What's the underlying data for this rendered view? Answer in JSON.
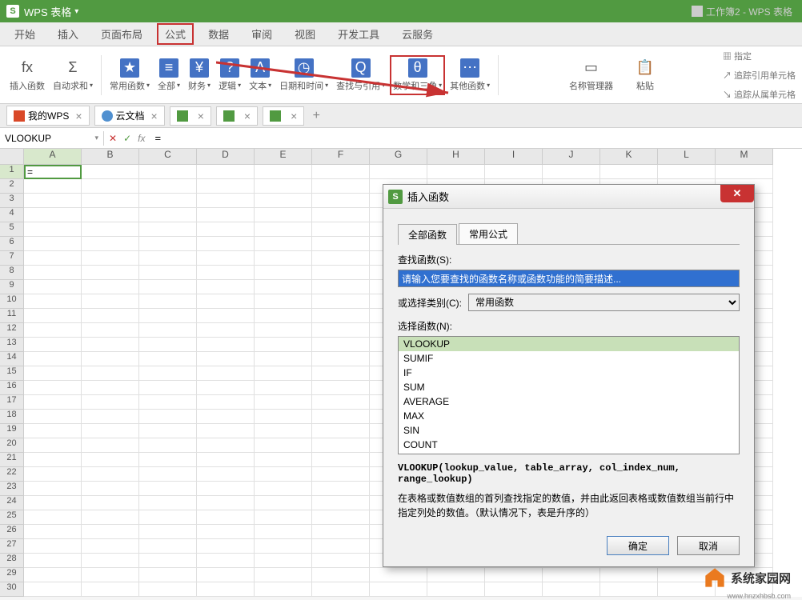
{
  "title_bar": {
    "app": "WPS 表格",
    "doc": "工作簿2 - WPS 表格"
  },
  "menu": {
    "items": [
      "开始",
      "插入",
      "页面布局",
      "公式",
      "数据",
      "审阅",
      "视图",
      "开发工具",
      "云服务"
    ],
    "active": "公式"
  },
  "ribbon": {
    "groups": [
      {
        "id": "insert-func",
        "icon": "fx",
        "label": "插入函数",
        "color": "plain"
      },
      {
        "id": "autosum",
        "icon": "Σ",
        "label": "自动求和",
        "color": "plain",
        "arrow": true
      },
      {
        "id": "common",
        "icon": "★",
        "label": "常用函数",
        "color": "blue",
        "arrow": true
      },
      {
        "id": "all",
        "icon": "≡",
        "label": "全部",
        "color": "blue",
        "arrow": true
      },
      {
        "id": "finance",
        "icon": "¥",
        "label": "财务",
        "color": "blue",
        "arrow": true
      },
      {
        "id": "logic",
        "icon": "?",
        "label": "逻辑",
        "color": "blue",
        "arrow": true
      },
      {
        "id": "text",
        "icon": "A",
        "label": "文本",
        "color": "blue",
        "arrow": true
      },
      {
        "id": "datetime",
        "icon": "◷",
        "label": "日期和时间",
        "color": "blue",
        "arrow": true
      },
      {
        "id": "lookup",
        "icon": "Q",
        "label": "查找与引用",
        "color": "blue",
        "arrow": true
      },
      {
        "id": "math",
        "icon": "θ",
        "label": "数学和三角",
        "color": "blue",
        "arrow": true
      },
      {
        "id": "other",
        "icon": "⋯",
        "label": "其他函数",
        "color": "blue",
        "arrow": true
      }
    ],
    "right": {
      "name_mgr": "名称管理器",
      "paste": "粘贴",
      "assign": "指定",
      "trace_prec": "追踪引用单元格",
      "trace_dep": "追踪从属单元格"
    }
  },
  "doc_tabs": {
    "tabs": [
      {
        "icon": "wps",
        "label": "我的WPS",
        "close": true
      },
      {
        "icon": "cloud",
        "label": "云文档",
        "close": true
      },
      {
        "icon": "green",
        "label": "",
        "close": true
      },
      {
        "icon": "green",
        "label": "",
        "close": true
      },
      {
        "icon": "green",
        "label": "",
        "close": true
      }
    ]
  },
  "formula_bar": {
    "name_box": "VLOOKUP",
    "formula": "="
  },
  "columns": [
    "A",
    "B",
    "C",
    "D",
    "E",
    "F",
    "G",
    "H",
    "I",
    "J",
    "K",
    "L",
    "M"
  ],
  "rows_count": 30,
  "active_cell": {
    "row": 1,
    "col": "A",
    "value": "="
  },
  "dialog": {
    "title": "插入函数",
    "tabs": {
      "all": "全部函数",
      "common": "常用公式"
    },
    "search_label": "查找函数(S):",
    "search_placeholder": "请输入您要查找的函数名称或函数功能的简要描述...",
    "cat_label": "或选择类别(C):",
    "cat_value": "常用函数",
    "select_label": "选择函数(N):",
    "functions": [
      "VLOOKUP",
      "SUMIF",
      "IF",
      "SUM",
      "AVERAGE",
      "MAX",
      "SIN",
      "COUNT"
    ],
    "selected": "VLOOKUP",
    "signature": "VLOOKUP(lookup_value, table_array, col_index_num, range_lookup)",
    "description": "在表格或数值数组的首列查找指定的数值，并由此返回表格或数值数组当前行中指定列处的数值。（默认情况下，表是升序的）",
    "ok": "确定",
    "cancel": "取消"
  },
  "watermark": {
    "text": "系统家园网",
    "url": "www.hnzxhbsb.com"
  }
}
